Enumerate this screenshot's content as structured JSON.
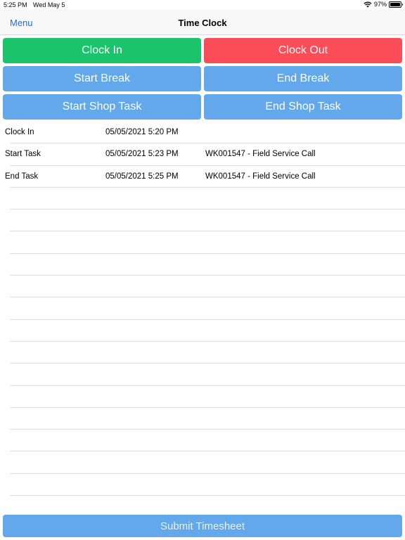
{
  "status_bar": {
    "time": "5:25 PM",
    "date": "Wed May 5",
    "battery": "97%",
    "battery_level": 0.97
  },
  "nav": {
    "menu_label": "Menu",
    "title": "Time Clock"
  },
  "buttons": {
    "clock_in": "Clock In",
    "clock_out": "Clock Out",
    "start_break": "Start Break",
    "end_break": "End Break",
    "start_shop_task": "Start Shop Task",
    "end_shop_task": "End Shop Task"
  },
  "entries": [
    {
      "type": "Clock In",
      "timestamp": "05/05/2021 5:20 PM",
      "task": ""
    },
    {
      "type": "Start Task",
      "timestamp": "05/05/2021 5:23 PM",
      "task": "WK001547 - Field Service Call"
    },
    {
      "type": "End Task",
      "timestamp": "05/05/2021 5:25 PM",
      "task": "WK001547 - Field Service Call"
    },
    {
      "type": "",
      "timestamp": "",
      "task": ""
    },
    {
      "type": "",
      "timestamp": "",
      "task": ""
    },
    {
      "type": "",
      "timestamp": "",
      "task": ""
    },
    {
      "type": "",
      "timestamp": "",
      "task": ""
    },
    {
      "type": "",
      "timestamp": "",
      "task": ""
    },
    {
      "type": "",
      "timestamp": "",
      "task": ""
    },
    {
      "type": "",
      "timestamp": "",
      "task": ""
    },
    {
      "type": "",
      "timestamp": "",
      "task": ""
    },
    {
      "type": "",
      "timestamp": "",
      "task": ""
    },
    {
      "type": "",
      "timestamp": "",
      "task": ""
    },
    {
      "type": "",
      "timestamp": "",
      "task": ""
    },
    {
      "type": "",
      "timestamp": "",
      "task": ""
    },
    {
      "type": "",
      "timestamp": "",
      "task": ""
    },
    {
      "type": "",
      "timestamp": "",
      "task": ""
    }
  ],
  "submit_label": "Submit Timesheet",
  "colors": {
    "green": "#1bc46a",
    "red": "#fb4d58",
    "blue": "#62a8ea",
    "link": "#1d6fe0"
  }
}
